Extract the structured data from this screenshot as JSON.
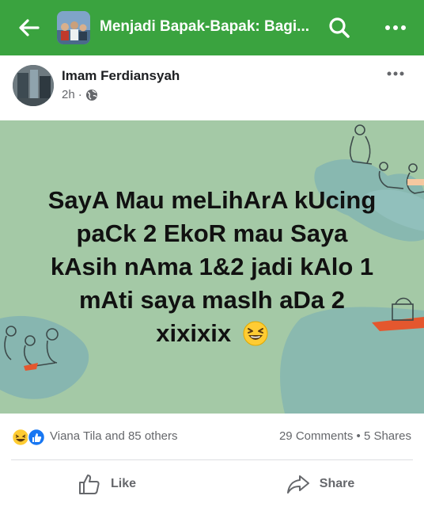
{
  "app": {
    "group_title": "Menjadi Bapak-Bapak: Bagi...",
    "accent_color": "#3aa33f",
    "icons": [
      "back-arrow-icon",
      "search-icon",
      "more-horizontal-icon"
    ]
  },
  "post": {
    "author": "Imam Ferdiansyah",
    "time": "2h",
    "privacy_icon": "globe-icon",
    "background_color": "#a4c9a6",
    "text_lines": [
      "SayA Mau meLihArA kUcing",
      "paCk 2 EkoR mau Saya",
      "kAsih nAma 1&2 jadi kAlo 1",
      "mAti saya masIh aDa 2",
      "xixixix"
    ],
    "emoji": "laughing-emoji-icon"
  },
  "stats": {
    "reactions_text": "Viana Tila and 85 others",
    "comments": "29 Comments",
    "separator": "•",
    "shares": "5 Shares"
  },
  "actions": {
    "like_label": "Like",
    "share_label": "Share"
  }
}
